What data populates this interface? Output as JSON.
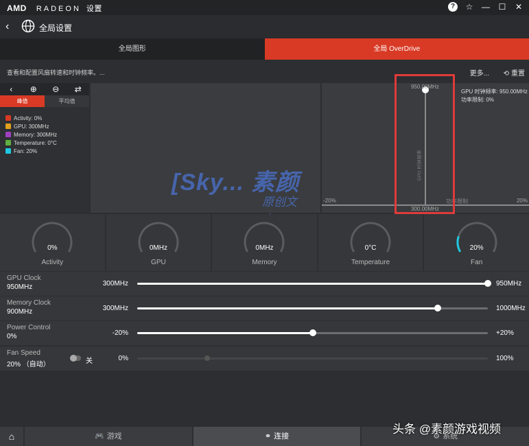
{
  "titlebar": {
    "amd": "AMD",
    "radeon": "RADEON",
    "settings": "设置"
  },
  "nav": {
    "title": "全局设置"
  },
  "tabs": [
    {
      "label": "全局图形"
    },
    {
      "label": "全局 OverDrive"
    }
  ],
  "desc": {
    "text": "查看和配置风扇转速和时钟频率。...",
    "more": "更多...",
    "reset": "重置"
  },
  "graph": {
    "tab_peak": "峰值",
    "tab_avg": "平均值",
    "legend": [
      {
        "label": "Activity: 0%",
        "color": "#d83a25"
      },
      {
        "label": "GPU: 300MHz",
        "color": "#e0a020"
      },
      {
        "label": "Memory: 300MHz",
        "color": "#a040c0"
      },
      {
        "label": "Temperature: 0°C",
        "color": "#60b040"
      },
      {
        "label": "Fan: 20%",
        "color": "#20c8e0"
      }
    ],
    "top_label": "950.00MHz",
    "bottom_label": "300.00MHz",
    "left_label": "-20%",
    "right_label": "20%",
    "power_label": "功率限制",
    "v_label": "GPU 时钟频率",
    "info_clock": "GPU 时钟频率: 950.00MHz",
    "info_power": "功率限制: 0%"
  },
  "watermark": {
    "main": "[Sky... 素颜",
    "sub": "原创文章]"
  },
  "gauges": [
    {
      "value": "0%",
      "label": "Activity",
      "level": 0
    },
    {
      "value": "0MHz",
      "label": "GPU",
      "level": 0
    },
    {
      "value": "0MHz",
      "label": "Memory",
      "level": 0
    },
    {
      "value": "0°C",
      "label": "Temperature",
      "level": 0
    },
    {
      "value": "20%",
      "label": "Fan",
      "level": 0.2
    }
  ],
  "sliders": {
    "gpu_clock": {
      "label": "GPU Clock",
      "value": "950MHz",
      "min": "300MHz",
      "max": "950MHz",
      "level": 1.0
    },
    "memory_clock": {
      "label": "Memory Clock",
      "value": "900MHz",
      "min": "300MHz",
      "max": "1000MHz",
      "level": 0.857
    },
    "power_control": {
      "label": "Power Control",
      "value": "0%",
      "min": "-20%",
      "max": "+20%",
      "level": 0.5
    },
    "fan_speed": {
      "label": "Fan Speed",
      "value": "20% （自动）",
      "toggle": "关",
      "min": "0%",
      "max": "100%",
      "level": 0.2
    }
  },
  "bottom": {
    "games": "游戏",
    "connect": "连接",
    "system": "系统"
  },
  "corner_watermark": "头条 @素颜游戏视频"
}
